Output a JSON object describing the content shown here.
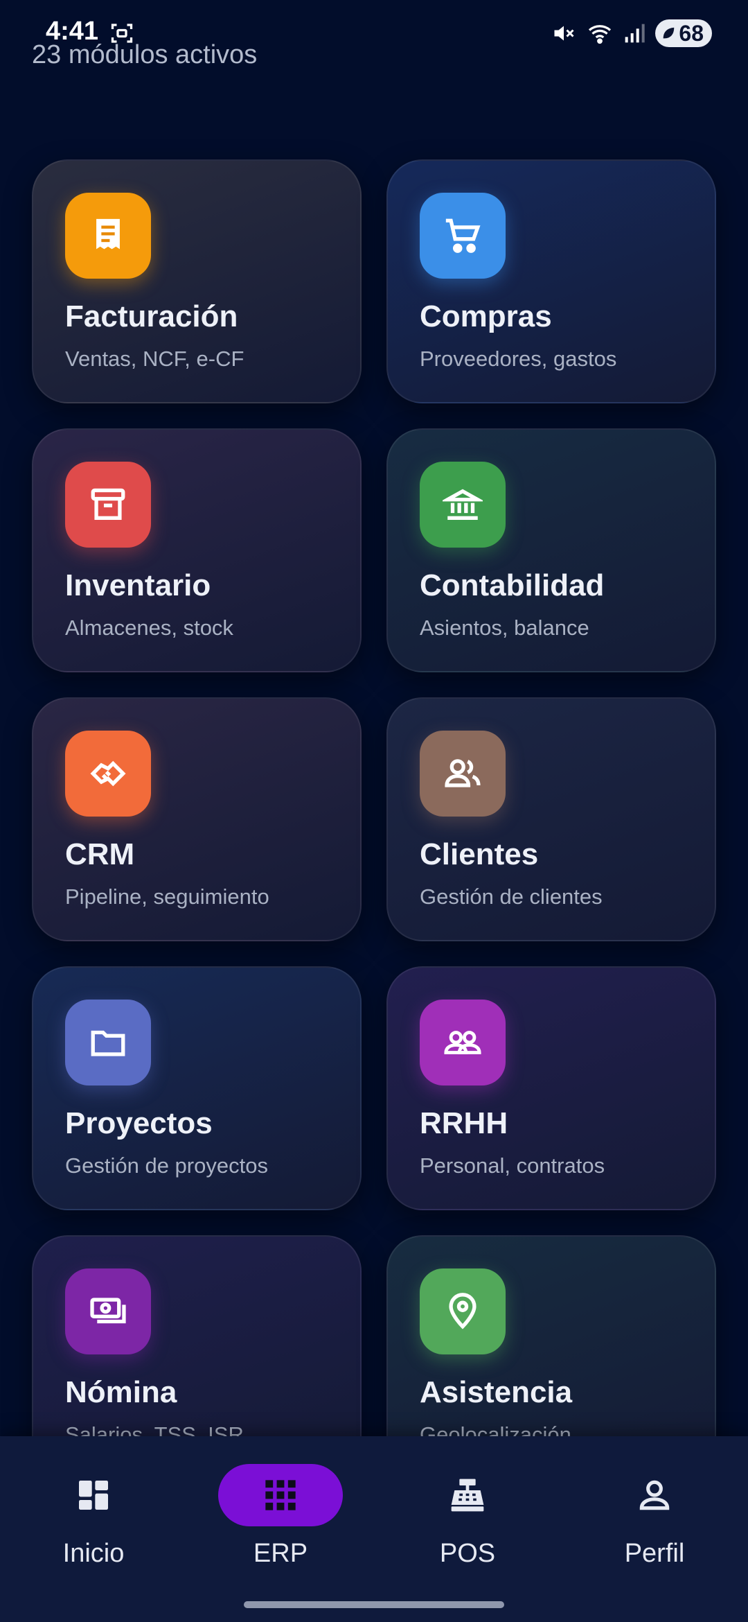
{
  "status_bar": {
    "time": "4:41",
    "battery": "68"
  },
  "header": {
    "subtitle": "23 módulos activos"
  },
  "modules": [
    {
      "title": "Facturación",
      "subtitle": "Ventas, NCF, e-CF",
      "icon": "receipt-icon",
      "color": "#f59b0b",
      "tint": "#2a2d3f"
    },
    {
      "title": "Compras",
      "subtitle": "Proveedores, gastos",
      "icon": "cart-icon",
      "color": "#3b8fe8",
      "tint": "#15295a"
    },
    {
      "title": "Inventario",
      "subtitle": "Almacenes, stock",
      "icon": "archive-icon",
      "color": "#df4b4b",
      "tint": "#2a2547"
    },
    {
      "title": "Contabilidad",
      "subtitle": "Asientos, balance",
      "icon": "bank-icon",
      "color": "#3d9e4d",
      "tint": "#172c42"
    },
    {
      "title": "CRM",
      "subtitle": "Pipeline, seguimiento",
      "icon": "handshake-icon",
      "color": "#f26b3a",
      "tint": "#2a2644"
    },
    {
      "title": "Clientes",
      "subtitle": "Gestión de clientes",
      "icon": "people-icon",
      "color": "#8b6a5c",
      "tint": "#1c2644"
    },
    {
      "title": "Proyectos",
      "subtitle": "Gestión de proyectos",
      "icon": "folder-icon",
      "color": "#5a6cc4",
      "tint": "#172a55"
    },
    {
      "title": "RRHH",
      "subtitle": "Personal, contratos",
      "icon": "group-icon",
      "color": "#a02fb8",
      "tint": "#221f4f"
    },
    {
      "title": "Nómina",
      "subtitle": "Salarios, TSS, ISR",
      "icon": "payments-icon",
      "color": "#7d26a6",
      "tint": "#1f1f4c"
    },
    {
      "title": "Asistencia",
      "subtitle": "Geolocalización",
      "icon": "location-pin-icon",
      "color": "#52a85a",
      "tint": "#172c40"
    }
  ],
  "nav": [
    {
      "label": "Inicio",
      "icon": "dashboard-icon",
      "active": false
    },
    {
      "label": "ERP",
      "icon": "apps-grid-icon",
      "active": true
    },
    {
      "label": "POS",
      "icon": "cash-register-icon",
      "active": false
    },
    {
      "label": "Perfil",
      "icon": "person-icon",
      "active": false
    }
  ],
  "accent_color": "#7b0fd6"
}
